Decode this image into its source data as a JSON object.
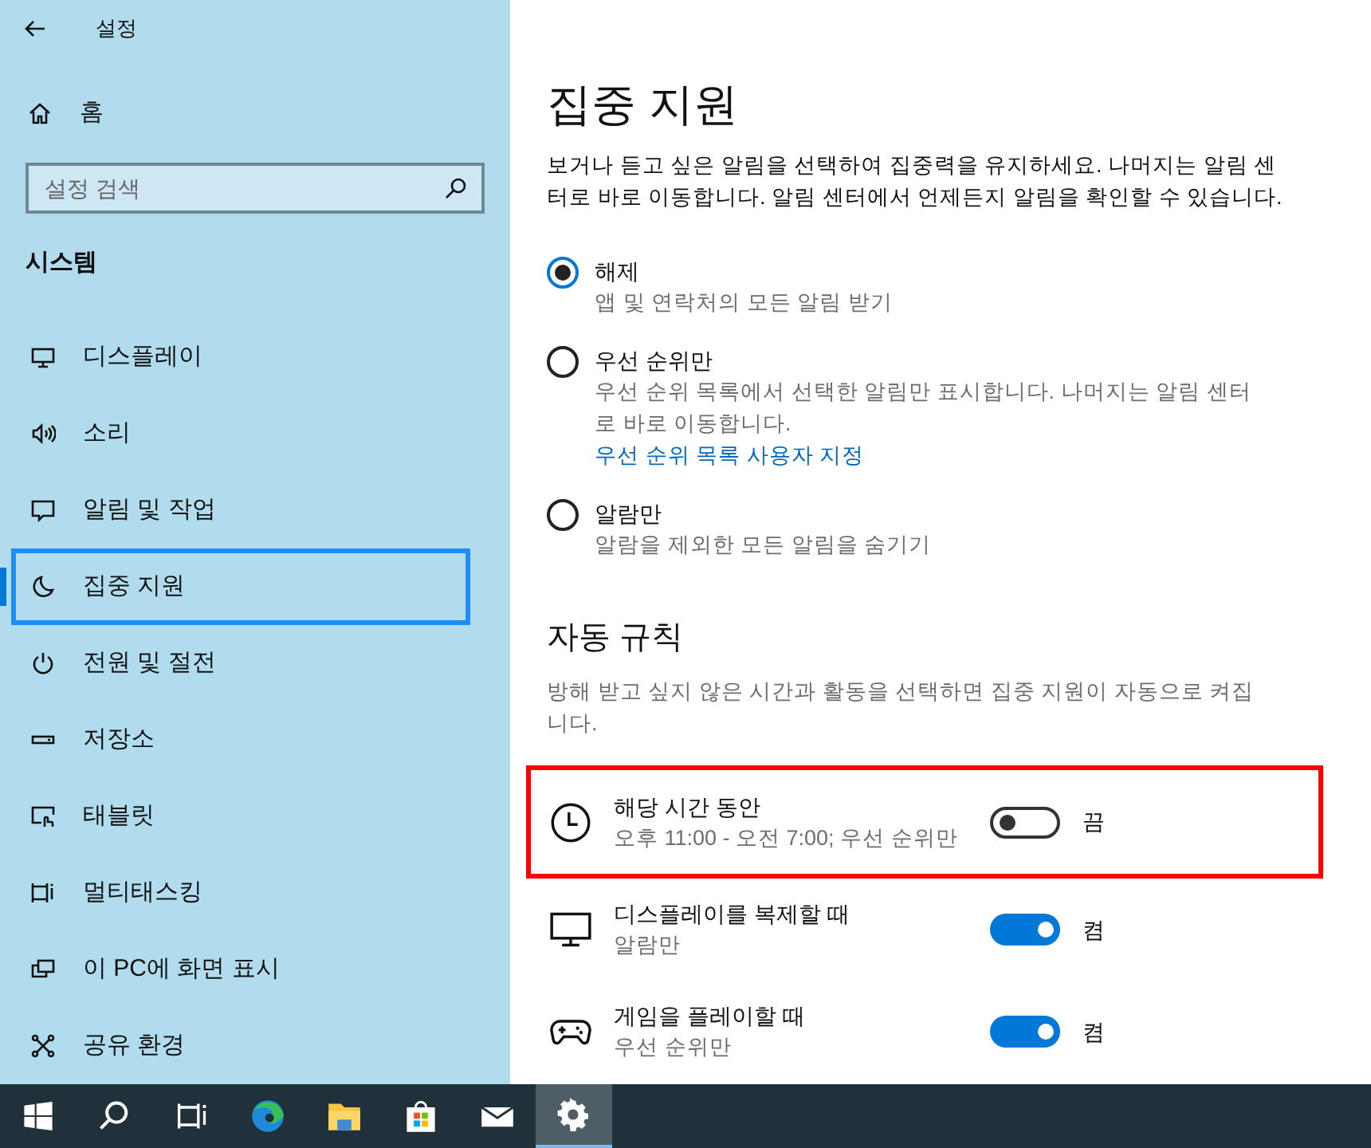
{
  "window": {
    "title": "설정"
  },
  "sidebar": {
    "home": "홈",
    "search": {
      "placeholder": "설정 검색"
    },
    "section": "시스템",
    "items": [
      {
        "label": "디스플레이",
        "selected": false
      },
      {
        "label": "소리",
        "selected": false
      },
      {
        "label": "알림 및 작업",
        "selected": false
      },
      {
        "label": "집중 지원",
        "selected": true
      },
      {
        "label": "전원 및 절전",
        "selected": false
      },
      {
        "label": "저장소",
        "selected": false
      },
      {
        "label": "태블릿",
        "selected": false
      },
      {
        "label": "멀티태스킹",
        "selected": false
      },
      {
        "label": "이 PC에 화면 표시",
        "selected": false
      },
      {
        "label": "공유 환경",
        "selected": false
      }
    ]
  },
  "main": {
    "title": "집중 지원",
    "description": "보거나 듣고 싶은 알림을 선택하여 집중력을 유지하세요. 나머지는 알림 센터로 바로 이동합니다. 알림 센터에서 언제든지 알림을 확인할 수 있습니다.",
    "options": [
      {
        "label": "해제",
        "description": "앱 및 연락처의 모든 알림 받기",
        "selected": true
      },
      {
        "label": "우선 순위만",
        "description": "우선 순위 목록에서 선택한 알림만 표시합니다. 나머지는 알림 센터로 바로 이동합니다.",
        "link": "우선 순위 목록 사용자 지정",
        "selected": false
      },
      {
        "label": "알람만",
        "description": "알람을 제외한 모든 알림을 숨기기",
        "selected": false
      }
    ],
    "rules_heading": "자동 규칙",
    "rules_description": "방해 받고 싶지 않은 시간과 활동을 선택하면 집중 지원이 자동으로 켜집니다.",
    "rules": [
      {
        "label": "해당 시간 동안",
        "detail": "오후 11:00 - 오전 7:00; 우선 순위만",
        "on": false,
        "state": "끔",
        "highlighted": true
      },
      {
        "label": "디스플레이를 복제할 때",
        "detail": "알람만",
        "on": true,
        "state": "켬",
        "highlighted": false
      },
      {
        "label": "게임을 플레이할 때",
        "detail": "우선 순위만",
        "on": true,
        "state": "켬",
        "highlighted": false
      }
    ]
  },
  "taskbar": [
    {
      "active": false
    },
    {
      "active": false
    },
    {
      "active": false
    },
    {
      "active": false
    },
    {
      "active": false
    },
    {
      "active": false
    },
    {
      "active": false
    },
    {
      "active": true
    }
  ]
}
